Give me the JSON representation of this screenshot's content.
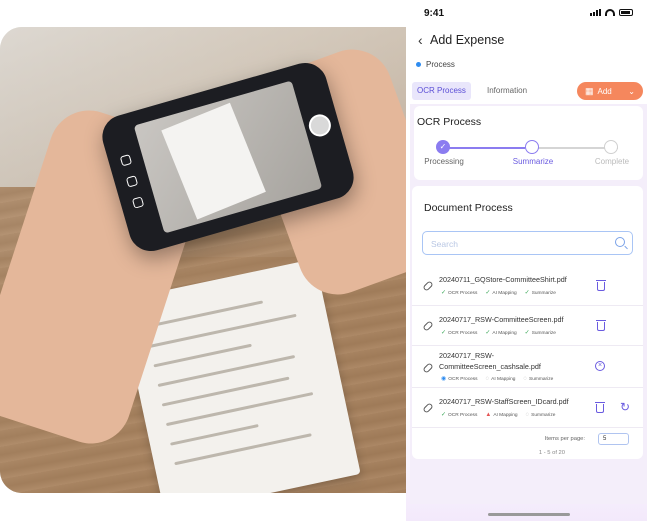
{
  "status_bar": {
    "time": "9:41"
  },
  "header": {
    "title": "Add Expense"
  },
  "process_tag": {
    "label": "Process"
  },
  "tabs": [
    {
      "label": "OCR Process",
      "active": true
    },
    {
      "label": "Information",
      "active": false
    }
  ],
  "add_button": {
    "label": "Add"
  },
  "ocr": {
    "title": "OCR Process",
    "steps": [
      {
        "label": "Processing",
        "state": "done"
      },
      {
        "label": "Summarize",
        "state": "current"
      },
      {
        "label": "Complete",
        "state": "pending"
      }
    ]
  },
  "documents": {
    "title": "Document Process",
    "search_placeholder": "Search",
    "files": [
      {
        "name": "20240711_GQStore-CommitteeShirt.pdf",
        "tags": [
          {
            "label": "OCR Process",
            "icon": "check-icon",
            "color": "#3aa757"
          },
          {
            "label": "AI Mapping",
            "icon": "check-icon",
            "color": "#3aa757"
          },
          {
            "label": "Summarize",
            "icon": "check-icon",
            "color": "#3aa757"
          }
        ],
        "actions": [
          "trash-icon"
        ]
      },
      {
        "name": "20240717_RSW-CommitteeScreen.pdf",
        "tags": [
          {
            "label": "OCR Process",
            "icon": "check-icon",
            "color": "#3aa757"
          },
          {
            "label": "AI Mapping",
            "icon": "check-icon",
            "color": "#3aa757"
          },
          {
            "label": "Summarize",
            "icon": "check-icon",
            "color": "#3aa757"
          }
        ],
        "actions": [
          "trash-icon"
        ]
      },
      {
        "name": "20240717_RSW-CommitteeScreen_cashsale.pdf",
        "name_line1": "20240717_RSW-",
        "name_line2": "CommitteeScreen_cashsale.pdf",
        "tags": [
          {
            "label": "OCR Process",
            "icon": "progress-icon",
            "color": "#2f8cf0"
          },
          {
            "label": "AI Mapping",
            "icon": "pending-icon",
            "color": "#999999"
          },
          {
            "label": "Summarize",
            "icon": "pending-icon",
            "color": "#999999"
          }
        ],
        "actions": [
          "circle-x-icon"
        ]
      },
      {
        "name": "20240717_RSW-StaffScreen_IDcard.pdf",
        "tags": [
          {
            "label": "OCR Process",
            "icon": "check-icon",
            "color": "#3aa757"
          },
          {
            "label": "AI Mapping",
            "icon": "error-icon",
            "color": "#e55353"
          },
          {
            "label": "Summarize",
            "icon": "pending-icon",
            "color": "#999999"
          }
        ],
        "actions": [
          "trash-icon",
          "refresh-icon"
        ]
      }
    ],
    "pagination": {
      "items_per_page_label": "Items per page:",
      "items_per_page_value": "5",
      "range": "1 - 5 of 20"
    }
  },
  "colors": {
    "accent": "#6a5be0",
    "add_button": "#f5875d",
    "step_done": "#8b7cf0",
    "step_pending": "#cfcfcf"
  }
}
